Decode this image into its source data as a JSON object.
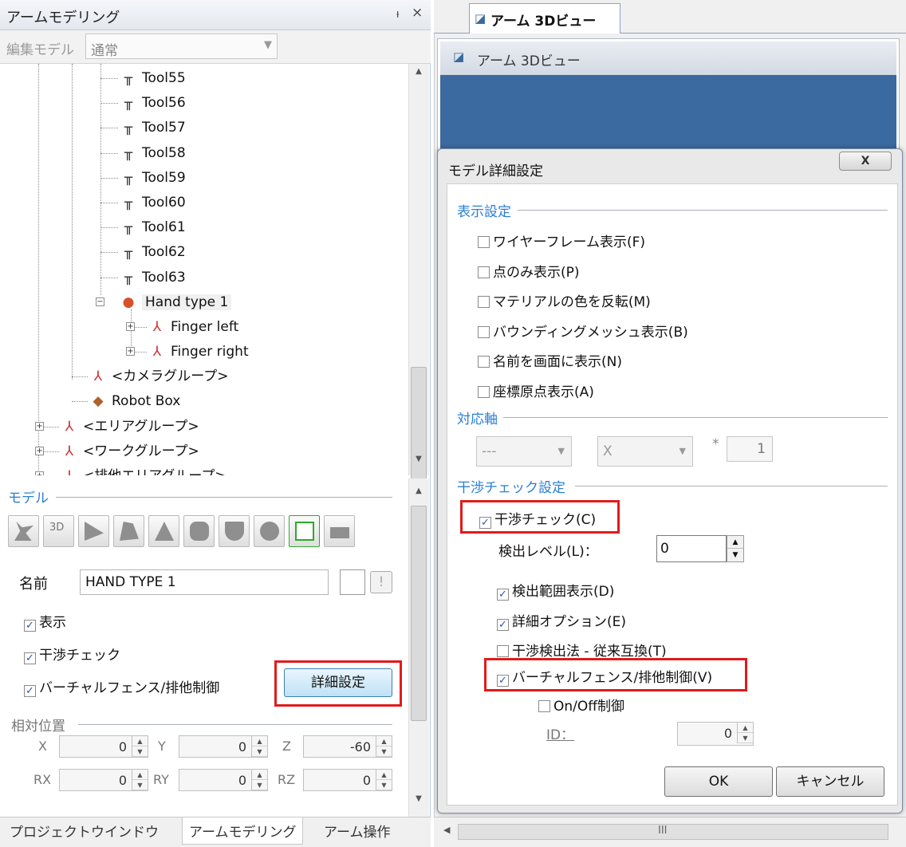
{
  "left_panel": {
    "title": "アームモデリング",
    "pin": "ᵼ",
    "close": "×",
    "edit_mode_label": "編集モデル",
    "edit_mode_value": "通常",
    "tree": [
      {
        "label": "Tool55",
        "icon": "tool-icon"
      },
      {
        "label": "Tool56",
        "icon": "tool-icon"
      },
      {
        "label": "Tool57",
        "icon": "tool-icon"
      },
      {
        "label": "Tool58",
        "icon": "tool-icon"
      },
      {
        "label": "Tool59",
        "icon": "tool-icon"
      },
      {
        "label": "Tool60",
        "icon": "tool-icon"
      },
      {
        "label": "Tool61",
        "icon": "tool-icon"
      },
      {
        "label": "Tool62",
        "icon": "tool-icon"
      },
      {
        "label": "Tool63",
        "icon": "tool-icon"
      },
      {
        "label": "Hand type 1",
        "icon": "hand-sphere-icon",
        "expanded": true,
        "selected": true
      },
      {
        "label": "Finger left",
        "icon": "axis-icon"
      },
      {
        "label": "Finger right",
        "icon": "axis-icon"
      },
      {
        "label": "<カメラグループ>",
        "icon": "axis-icon"
      },
      {
        "label": "Robot Box",
        "icon": "box-icon"
      },
      {
        "label": "<エリアグループ>",
        "icon": "axis-icon"
      },
      {
        "label": "<ワークグループ>",
        "icon": "axis-icon"
      },
      {
        "label": "<排他エリアグループ>",
        "icon": "axis-icon"
      }
    ],
    "model_section": "モデル",
    "toolbar_icons": [
      "robot-icon",
      "3d-view-icon",
      "wedge-icon",
      "polygon-icon",
      "cone-icon",
      "cylinder-icon",
      "shield-shape-icon",
      "sphere-icon",
      "mesh-icon",
      "fence-icon"
    ],
    "name_label": "名前",
    "name_value": "HAND TYPE 1",
    "info_button": "!",
    "show_label": "表示",
    "interference_label": "干渉チェック",
    "virtual_fence_label": "バーチャルフェンス/排他制御",
    "detail_button": "詳細設定",
    "relative_position": "相対位置",
    "positions": [
      {
        "axis": "X",
        "value": "0"
      },
      {
        "axis": "Y",
        "value": "0"
      },
      {
        "axis": "Z",
        "value": "-60"
      },
      {
        "axis": "RX",
        "value": "0"
      },
      {
        "axis": "RY",
        "value": "0"
      },
      {
        "axis": "RZ",
        "value": "0"
      }
    ],
    "tabs": [
      "プロジェクトウインドウ",
      "アームモデリング",
      "アーム操作"
    ],
    "active_tab": "アームモデリング"
  },
  "right_panel": {
    "tab_label": "アーム 3Dビュー",
    "view_header": "アーム 3Dビュー",
    "scroll_grip": "III"
  },
  "dialog": {
    "title": "モデル詳細設定",
    "close": "X",
    "display_section": "表示設定",
    "display_options": [
      {
        "label": "ワイヤーフレーム表示(F)",
        "checked": false
      },
      {
        "label": "点のみ表示(P)",
        "checked": false
      },
      {
        "label": "マテリアルの色を反転(M)",
        "checked": false
      },
      {
        "label": "バウンディングメッシュ表示(B)",
        "checked": false
      },
      {
        "label": "名前を画面に表示(N)",
        "checked": false
      },
      {
        "label": "座標原点表示(A)",
        "checked": false
      }
    ],
    "axis_section": "対応軸",
    "axis_combo1": "---",
    "axis_combo2": "X",
    "axis_multiplier": "*",
    "axis_value": "1",
    "interference_section": "干渉チェック設定",
    "interference_check": "干渉チェック(C)",
    "detect_level_label": "検出レベル(L)：",
    "detect_level_value": "0",
    "interference_options": [
      {
        "label": "検出範囲表示(D)",
        "checked": true
      },
      {
        "label": "詳細オプション(E)",
        "checked": true
      },
      {
        "label": "干渉検出法 - 従来互換(T)",
        "checked": false
      }
    ],
    "virtual_fence": "バーチャルフェンス/排他制御(V)",
    "onoff_label": "On/Off制御",
    "id_label": "ID：",
    "id_value": "0",
    "ok": "OK",
    "cancel": "キャンセル"
  },
  "colors": {
    "highlight": "#e01b1b",
    "section_blue": "#2a7fd4",
    "view_blue": "#3a6aa0"
  }
}
